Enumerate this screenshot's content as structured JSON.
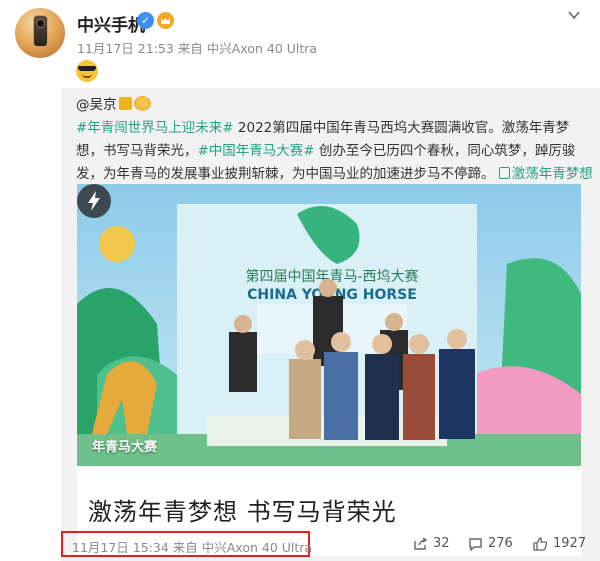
{
  "post": {
    "username": "中兴手机",
    "meta": "11月17日 21:53 来自 中兴Axon 40 Ultra",
    "emoji": "cool-face"
  },
  "repost": {
    "author": "@吴京",
    "text_parts": [
      {
        "type": "tag",
        "text": "#年青闯世界马上迎未来#"
      },
      {
        "type": "text",
        "text": " 2022第四届中国年青马西坞大赛圆满收官。激荡年青梦想，书写马背荣光，"
      },
      {
        "type": "tag",
        "text": "#中国年青马大赛#"
      },
      {
        "type": "text",
        "text": " 创办至今已历四个春秋，同心筑梦，踔厉骏发，为年青马的发展事业披荆斩棘，为中国马业的加速进步马不停蹄。"
      },
      {
        "type": "tag",
        "text": "激荡年青梦想 书写马背荣光"
      }
    ],
    "photo_badge": "年青马大赛",
    "photo_caption": "激荡年青梦想 书写马背荣光",
    "banner_title_cn": "第四届中国年青马-西坞大赛",
    "banner_title_en": "CHINA YOUNG HORSE",
    "footer_time": "11月17日 15:34 来自 中兴Axon 40 Ultra",
    "stats": {
      "shares": "32",
      "comments": "276",
      "likes": "1927"
    }
  },
  "colors": {
    "tag_green": "#26a085",
    "highlight_red": "#e0201c",
    "verified_blue": "#3d8ef5"
  }
}
